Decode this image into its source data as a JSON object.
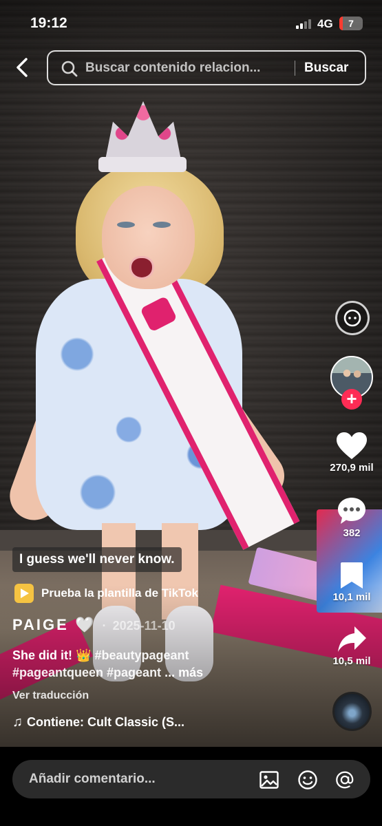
{
  "status_bar": {
    "time": "19:12",
    "network": "4G",
    "battery": "7"
  },
  "search": {
    "placeholder": "Buscar contenido relacion...",
    "button_label": "Buscar"
  },
  "right_rail": {
    "likes": "270,9 mil",
    "comments": "382",
    "saves": "10,1 mil",
    "shares": "10,5 mil",
    "follow_symbol": "+"
  },
  "video_overlay": {
    "sticker_text": "I guess we'll never know."
  },
  "template_link": {
    "label": "Prueba la plantilla de TikTok"
  },
  "post": {
    "username": "PAIGE",
    "username_emoji": "🤍",
    "separator": "·",
    "date": "2025-11-10",
    "caption_text": "She did it! 👑",
    "hashtags_line1": "#beautypageant",
    "hashtags_line2": "#pageantqueen #pageant",
    "more_label": "... más",
    "translate_label": "Ver traducción",
    "music_label": "Contiene: Cult Classic (S..."
  },
  "comment_bar": {
    "placeholder": "Añadir comentario..."
  },
  "colors": {
    "accent": "#fe2c55",
    "battery_low": "#ff3b30",
    "template_icon": "#f5c342"
  }
}
